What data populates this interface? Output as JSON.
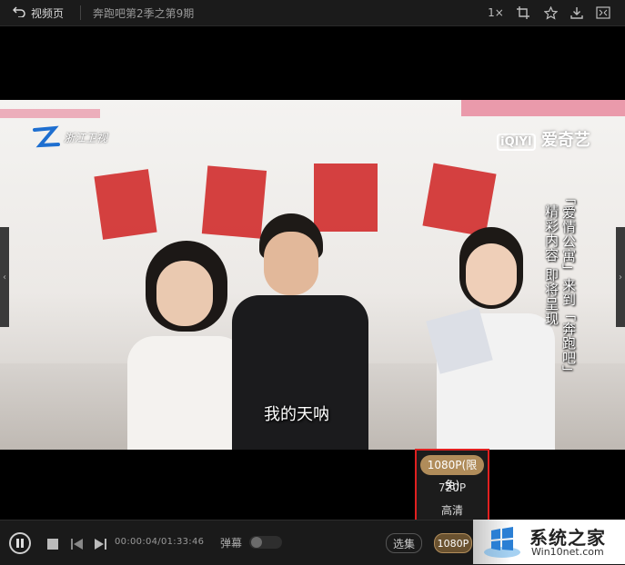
{
  "header": {
    "back_label": "视频页",
    "title": "奔跑吧第2季之第9期",
    "speed_label": "1×"
  },
  "video": {
    "channel_logo": "浙江卫视",
    "platform_logo": "爱奇艺",
    "platform_logo_prefix": "iQIYI",
    "promo_line_1": "「爱情公寓」来到「奔跑吧」",
    "promo_line_2": "精彩内容 即将呈现",
    "subtitle": "我的天呐"
  },
  "quality_menu": {
    "options": [
      "1080P(限免)",
      "720P",
      "高清"
    ],
    "selected": "1080P(限免)"
  },
  "controls": {
    "time": "00:00:04/01:33:46",
    "danmu_label": "弹幕",
    "episodes_label": "选集",
    "quality_label": "1080P"
  },
  "watermark": {
    "name": "系统之家",
    "url": "Win10net.com"
  },
  "colors": {
    "accent": "#b08c5a",
    "highlight_border": "#e02020",
    "background": "#000000"
  },
  "icons": [
    "back-arrow-icon",
    "crop-icon",
    "star-icon",
    "download-icon",
    "fullscreen-icon",
    "pause-icon",
    "stop-icon",
    "prev-icon",
    "next-icon",
    "chevron-left-icon",
    "chevron-right-icon"
  ]
}
